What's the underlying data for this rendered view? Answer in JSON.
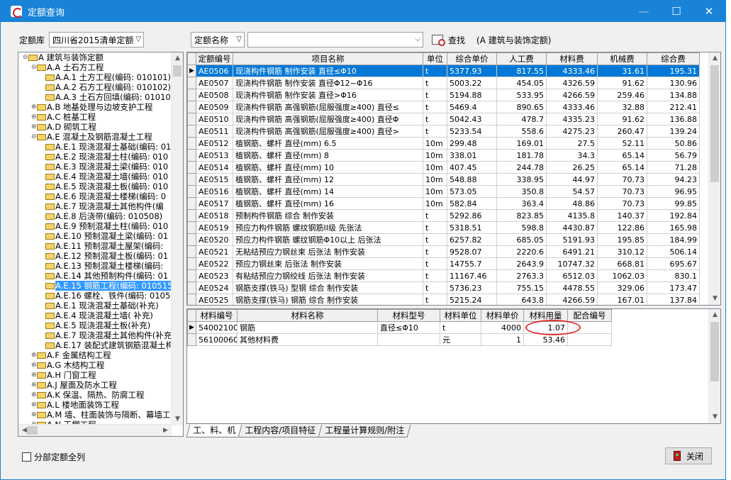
{
  "window": {
    "title": "定额查询",
    "min": "—",
    "max": "☐",
    "close": "✕"
  },
  "library": {
    "label": "定额库",
    "value": "四川省2015清单定额"
  },
  "search": {
    "field_value": "定额名称",
    "query": "",
    "find_label": "查找",
    "scope": "(A 建筑与装饰定额)"
  },
  "tree": [
    {
      "text": "A 建筑与装饰定额",
      "level": 0,
      "exp": "⊖"
    },
    {
      "text": "A.A 土石方工程",
      "level": 1,
      "exp": "⊖"
    },
    {
      "text": "A.A.1 土方工程(编码: 010101)",
      "level": 2,
      "exp": ""
    },
    {
      "text": "A.A.2 石方工程(编码: 010102)",
      "level": 2,
      "exp": ""
    },
    {
      "text": "A.A.3 土石方回填(编码: 01010",
      "level": 2,
      "exp": ""
    },
    {
      "text": "A.B 地基处理与边坡支护工程",
      "level": 1,
      "exp": "⊕"
    },
    {
      "text": "A.C 桩基工程",
      "level": 1,
      "exp": "⊕"
    },
    {
      "text": "A.D 砌筑工程",
      "level": 1,
      "exp": "⊕"
    },
    {
      "text": "A.E 混凝土及钢筋混凝土工程",
      "level": 1,
      "exp": "⊖"
    },
    {
      "text": "A.E.1 现浇混凝土基础(编码: 010",
      "level": 2,
      "exp": ""
    },
    {
      "text": "A.E.2 现浇混凝土柱(编码: 010",
      "level": 2,
      "exp": ""
    },
    {
      "text": "A.E.3 现浇混凝土梁(编码: 010",
      "level": 2,
      "exp": ""
    },
    {
      "text": "A.E.4 现浇混凝土墙(编码: 010",
      "level": 2,
      "exp": ""
    },
    {
      "text": "A.E.5 现浇混凝土板(编码: 010",
      "level": 2,
      "exp": ""
    },
    {
      "text": "A.E.6 现浇混凝土楼梯(编码: 0",
      "level": 2,
      "exp": ""
    },
    {
      "text": "A.E.7 现浇混凝土其他构件(编",
      "level": 2,
      "exp": ""
    },
    {
      "text": "A.E.8 后浇带(编码: 010508)",
      "level": 2,
      "exp": ""
    },
    {
      "text": "A.E.9 预制混凝土柱(编码: 010",
      "level": 2,
      "exp": ""
    },
    {
      "text": "A.E.10 预制混凝土梁(编码: 01",
      "level": 2,
      "exp": ""
    },
    {
      "text": "A.E.11 预制混凝土屋架(编码:",
      "level": 2,
      "exp": ""
    },
    {
      "text": "A.E.12 预制混凝土板(编码: 01",
      "level": 2,
      "exp": ""
    },
    {
      "text": "A.E.13 预制混凝土楼梯(编码:",
      "level": 2,
      "exp": ""
    },
    {
      "text": "A.E.14 其他预制构件(编码: 01",
      "level": 2,
      "exp": ""
    },
    {
      "text": "A.E.15 钢筋工程(编码: 010515",
      "level": 2,
      "exp": "",
      "selected": true
    },
    {
      "text": "A.E.16 螺栓、铁件(编码: 0105",
      "level": 2,
      "exp": ""
    },
    {
      "text": "A.E.1 现浇混凝土基础(补充)",
      "level": 2,
      "exp": ""
    },
    {
      "text": "A.E.4 现浇混凝土墙( 补充)",
      "level": 2,
      "exp": ""
    },
    {
      "text": "A.E.5 现浇混凝土板(补充)",
      "level": 2,
      "exp": ""
    },
    {
      "text": "A.E.7 现浇混凝土其他构件(补充",
      "level": 2,
      "exp": ""
    },
    {
      "text": "A.E.17 装配式建筑钢筋混凝土构",
      "level": 2,
      "exp": ""
    },
    {
      "text": "A.F 金属结构工程",
      "level": 1,
      "exp": "⊕"
    },
    {
      "text": "A.G 木结构工程",
      "level": 1,
      "exp": "⊕"
    },
    {
      "text": "A.H 门窗工程",
      "level": 1,
      "exp": "⊕"
    },
    {
      "text": "A.J 屋面及防水工程",
      "level": 1,
      "exp": "⊕"
    },
    {
      "text": "A.K 保温、隔热、防腐工程",
      "level": 1,
      "exp": "⊕"
    },
    {
      "text": "A.L 楼地面装饰工程",
      "level": 1,
      "exp": "⊕"
    },
    {
      "text": "A.M 墙、柱面装饰与隔断、幕墙工",
      "level": 1,
      "exp": "⊕"
    },
    {
      "text": "A.N 天棚工程",
      "level": 1,
      "exp": "⊕"
    }
  ],
  "quota_table": {
    "headers": [
      "定额编号",
      "项目名称",
      "单位",
      "综合单价",
      "人工费",
      "材料费",
      "机械费",
      "综合费"
    ],
    "rows": [
      [
        "AE0506",
        "现浇构件钢筋 制作安装 直径≤Φ10",
        "t",
        "5377.93",
        "817.55",
        "4333.46",
        "31.61",
        "195.31"
      ],
      [
        "AE0507",
        "现浇构件钢筋 制作安装 直径Φ12~Φ16",
        "t",
        "5003.22",
        "454.05",
        "4326.59",
        "91.62",
        "130.96"
      ],
      [
        "AE0508",
        "现浇构件钢筋 制作安装 直径>Φ16",
        "t",
        "5194.88",
        "533.95",
        "4266.59",
        "259.46",
        "134.88"
      ],
      [
        "AE0509",
        "现浇构件钢筋 高强钢筋(屈服强度≥400) 直径≤",
        "t",
        "5469.4",
        "890.65",
        "4333.46",
        "32.88",
        "212.41"
      ],
      [
        "AE0510",
        "现浇构件钢筋 高强钢筋(屈服强度≥400) 直径Φ",
        "t",
        "5042.43",
        "478.7",
        "4335.23",
        "91.62",
        "136.88"
      ],
      [
        "AE0511",
        "现浇构件钢筋 高强钢筋(屈服强度≥400) 直径>",
        "t",
        "5233.54",
        "558.6",
        "4275.23",
        "260.47",
        "139.24"
      ],
      [
        "AE0512",
        "植钢筋、螺杆 直径(mm) 6.5",
        "10m",
        "299.48",
        "169.01",
        "27.5",
        "52.11",
        "50.86"
      ],
      [
        "AE0513",
        "植钢筋、螺杆 直径(mm) 8",
        "10m",
        "338.01",
        "181.78",
        "34.3",
        "65.14",
        "56.79"
      ],
      [
        "AE0514",
        "植钢筋、螺杆 直径(mm) 10",
        "10m",
        "407.45",
        "244.78",
        "26.25",
        "65.14",
        "71.28"
      ],
      [
        "AE0515",
        "植钢筋、螺杆 直径(mm) 12",
        "10m",
        "548.88",
        "338.95",
        "44.97",
        "70.73",
        "94.23"
      ],
      [
        "AE0516",
        "植钢筋、螺杆 直径(mm) 14",
        "10m",
        "573.05",
        "350.8",
        "54.57",
        "70.73",
        "96.95"
      ],
      [
        "AE0517",
        "植钢筋、螺杆 直径(mm) 16",
        "10m",
        "582.84",
        "363.4",
        "48.86",
        "70.73",
        "99.85"
      ],
      [
        "AE0518",
        "预制构件钢筋 综合 制作安装",
        "t",
        "5292.86",
        "823.85",
        "4135.8",
        "140.37",
        "192.84"
      ],
      [
        "AE0519",
        "预应力构件钢筋 螺纹钢筋II级 先张法",
        "t",
        "5318.51",
        "598.8",
        "4430.87",
        "122.86",
        "165.98"
      ],
      [
        "AE0520",
        "预应力构件钢筋 螺纹钢筋Φ10以上 后张法",
        "t",
        "6257.82",
        "685.05",
        "5191.93",
        "195.85",
        "184.99"
      ],
      [
        "AE0521",
        "无粘结预应力钢丝束 后张法 制作安装",
        "t",
        "9528.07",
        "2220.6",
        "6491.21",
        "310.12",
        "506.14"
      ],
      [
        "AE0522",
        "预应力钢丝束 后张法 制作安装",
        "t",
        "14755.7",
        "2643.9",
        "10747.32",
        "668.81",
        "695.67"
      ],
      [
        "AE0523",
        "有粘结预应力钢绞线 后张法 制作安装",
        "t",
        "11167.46",
        "2763.3",
        "6512.03",
        "1062.03",
        "830.1"
      ],
      [
        "AE0524",
        "钢筋支撑(铁马) 型钢 综合 制作安装",
        "t",
        "5736.23",
        "755.15",
        "4478.55",
        "329.06",
        "173.47"
      ],
      [
        "AE0525",
        "钢筋支撑(铁马) 钢筋 综合 制作安装",
        "t",
        "5215.24",
        "643.8",
        "4266.59",
        "167.01",
        "137.84"
      ]
    ]
  },
  "material_table": {
    "headers": [
      "材料编号",
      "材料名称",
      "材料型号",
      "材料单位",
      "材料单价",
      "材料用量",
      "配合编号"
    ],
    "rows": [
      [
        "54002100",
        "钢筋",
        "直径≤Φ10",
        "t",
        "4000",
        "1.07",
        ""
      ],
      [
        "56100060",
        "其他材料费",
        "",
        "元",
        "1",
        "53.46",
        ""
      ]
    ]
  },
  "tabs": [
    "工、料、机",
    "工程内容/项目特征",
    "工程量计算规则/附注"
  ],
  "footer": {
    "checkbox_label": "分部定额全列",
    "close_label": "关闭"
  }
}
